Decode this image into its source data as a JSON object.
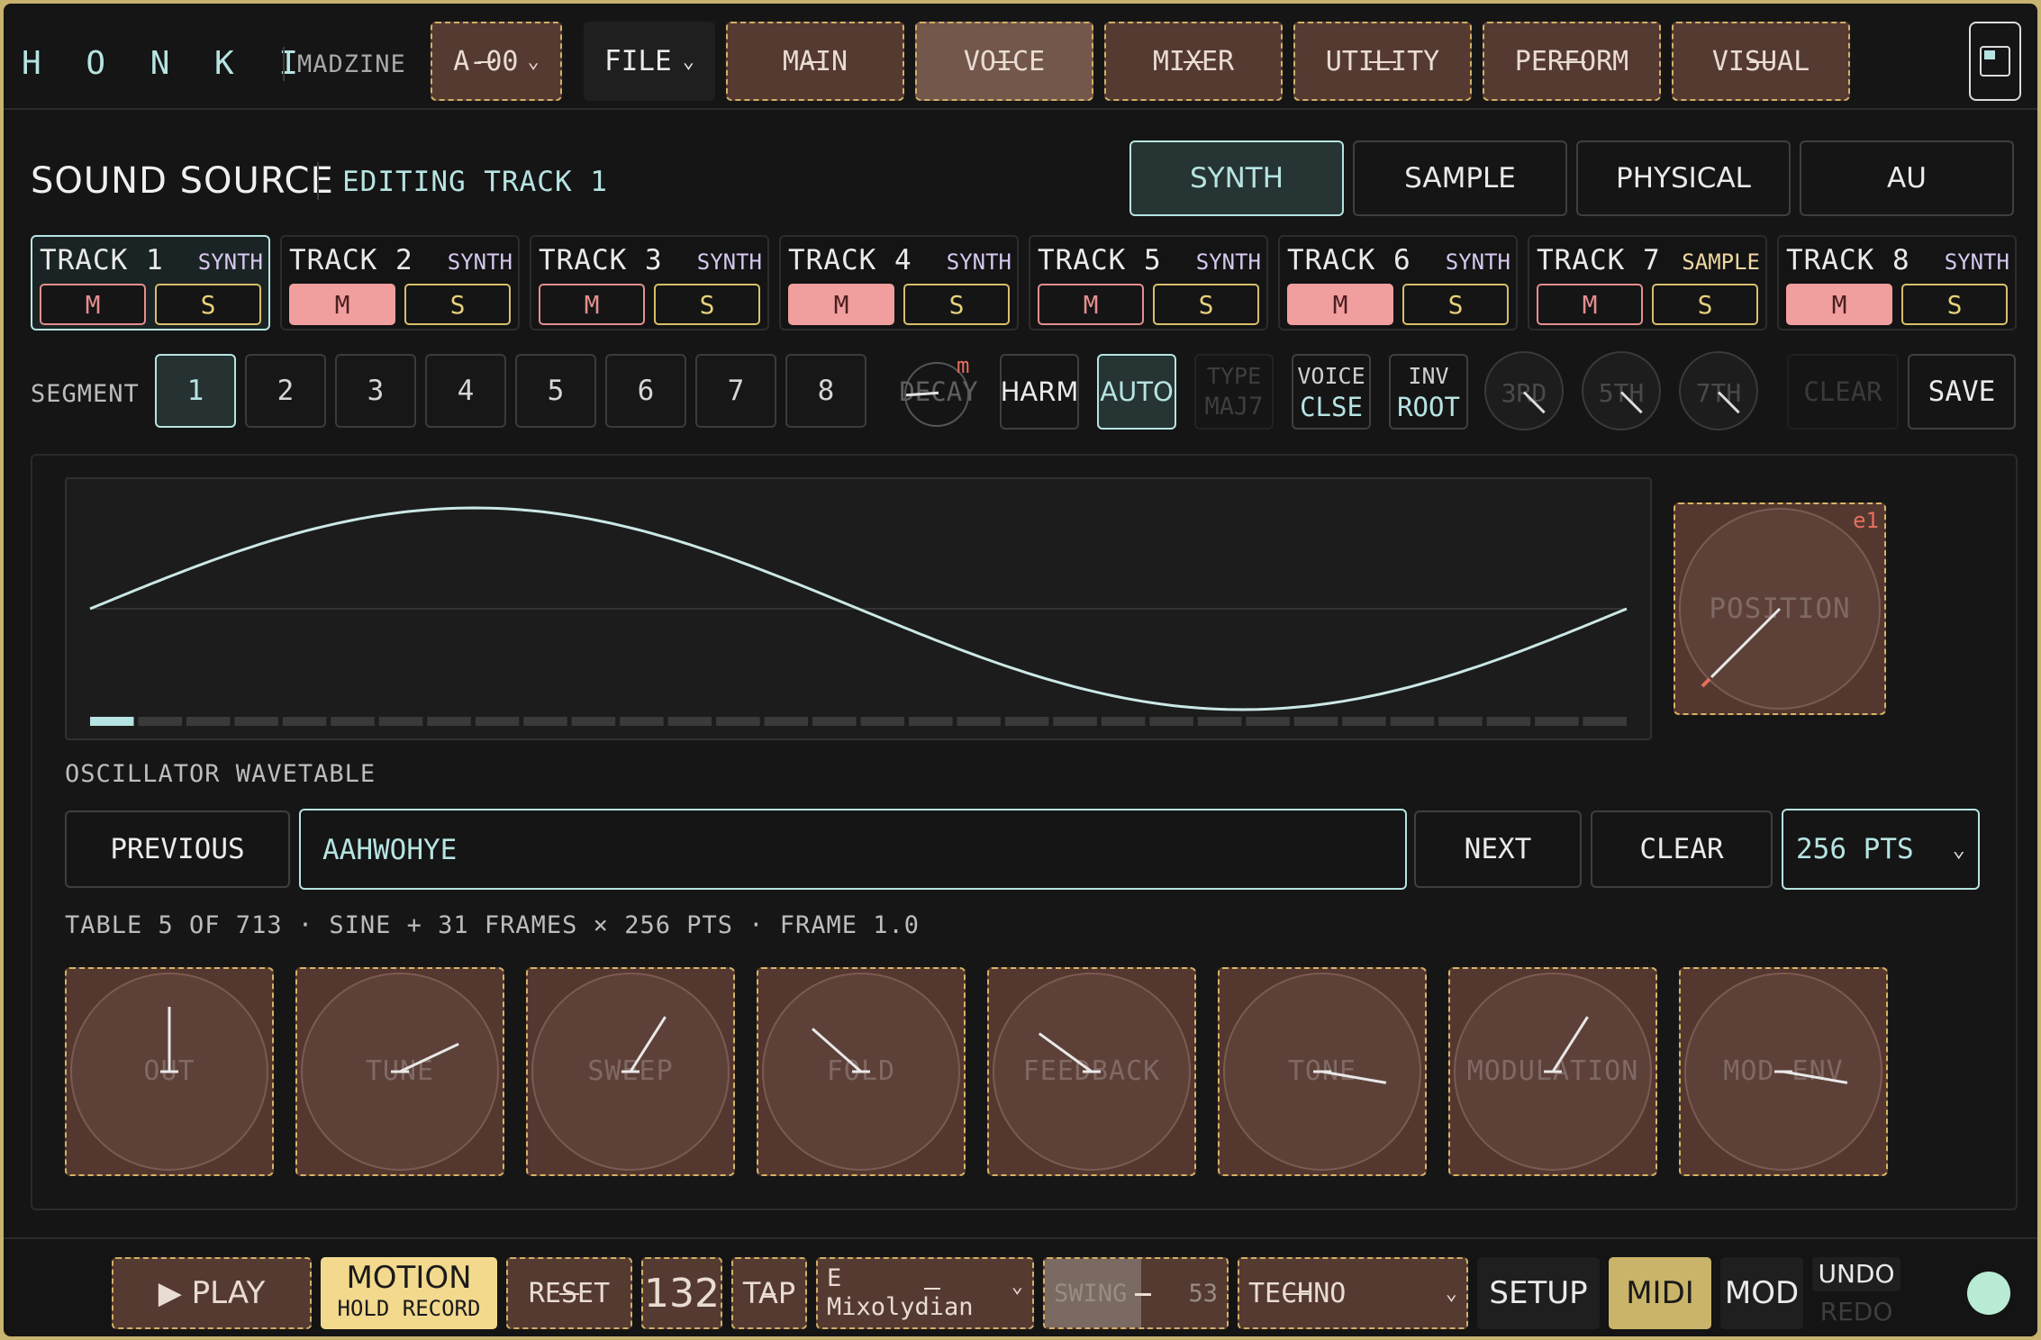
{
  "header": {
    "logo": "H O N K I",
    "madzine_label": "MADZINE",
    "preset": "A-00",
    "file_label": "FILE",
    "tabs": [
      {
        "label": "MAIN",
        "active": false
      },
      {
        "label": "VOICE",
        "active": true
      },
      {
        "label": "MIXER",
        "active": false
      },
      {
        "label": "UTILITY",
        "active": false
      },
      {
        "label": "PERFORM",
        "active": false
      },
      {
        "label": "VISUAL",
        "active": false
      }
    ]
  },
  "section": {
    "title": "SOUND SOURCE",
    "subtitle": "EDITING TRACK 1",
    "source_tabs": [
      {
        "label": "SYNTH",
        "active": true
      },
      {
        "label": "SAMPLE",
        "active": false
      },
      {
        "label": "PHYSICAL",
        "active": false
      },
      {
        "label": "AU",
        "active": false
      }
    ]
  },
  "tracks": [
    {
      "name": "TRACK 1",
      "type": "SYNTH",
      "mute": false,
      "active": true
    },
    {
      "name": "TRACK 2",
      "type": "SYNTH",
      "mute": true,
      "active": false
    },
    {
      "name": "TRACK 3",
      "type": "SYNTH",
      "mute": false,
      "active": false
    },
    {
      "name": "TRACK 4",
      "type": "SYNTH",
      "mute": true,
      "active": false
    },
    {
      "name": "TRACK 5",
      "type": "SYNTH",
      "mute": false,
      "active": false
    },
    {
      "name": "TRACK 6",
      "type": "SYNTH",
      "mute": true,
      "active": false
    },
    {
      "name": "TRACK 7",
      "type": "SAMPLE",
      "mute": false,
      "active": false
    },
    {
      "name": "TRACK 8",
      "type": "SYNTH",
      "mute": true,
      "active": false
    }
  ],
  "track_buttons": {
    "mute": "M",
    "solo": "S"
  },
  "segment": {
    "label": "SEGMENT",
    "items": [
      "1",
      "2",
      "3",
      "4",
      "5",
      "6",
      "7",
      "8"
    ],
    "selected": "1",
    "decay_label": "DECAY",
    "decay_marker": "m",
    "harm_label": "HARM",
    "auto_label": "AUTO",
    "type_label": "TYPE",
    "type_value": "MAJ7",
    "voice_label": "VOICE",
    "voice_value": "CLSE",
    "inv_label": "INV",
    "inv_value": "ROOT",
    "intervals": [
      "3RD",
      "5TH",
      "7TH"
    ],
    "clear_label": "CLEAR",
    "save_label": "SAVE"
  },
  "wavetable": {
    "position_label": "POSITION",
    "position_tag": "e1",
    "frame_count": 32,
    "current_frame": 1,
    "section_label": "OSCILLATOR WAVETABLE",
    "previous_label": "PREVIOUS",
    "name": "AAHWOHYE",
    "next_label": "NEXT",
    "clear_label": "CLEAR",
    "points": "256 PTS",
    "info": "TABLE 5 OF 713 · SINE + 31 FRAMES × 256 PTS · FRAME 1.0"
  },
  "knobs": [
    {
      "label": "OUT",
      "value": 0.5
    },
    {
      "label": "TUNE",
      "value": 0.74
    },
    {
      "label": "SWEEP",
      "value": 0.62
    },
    {
      "label": "FOLD",
      "value": 0.32
    },
    {
      "label": "FEEDBACK",
      "value": 0.3
    },
    {
      "label": "TONE",
      "value": 0.87
    },
    {
      "label": "MODULATION",
      "value": 0.62
    },
    {
      "label": "MOD-ENV",
      "value": 0.87
    }
  ],
  "transport": {
    "play_label": "▶ PLAY",
    "motion_label": "MOTION",
    "motion_sub": "HOLD RECORD",
    "reset_label": "RESET",
    "tempo": "132",
    "tap_label": "TAP",
    "scale_key": "E",
    "scale_mode": "Mixolydian",
    "swing_label": "SWING",
    "swing_value": "53",
    "swing_fraction": 0.53,
    "genre": "TECHNO",
    "setup_label": "SETUP",
    "midi_label": "MIDI",
    "mod_label": "MOD",
    "undo_label": "UNDO",
    "redo_label": "REDO"
  },
  "colors": {
    "accent_cyan": "#b6e4e2",
    "mute_pink": "#f19e9e",
    "solo_yellow": "#d8c06a",
    "brown_bg": "#553a32",
    "motion_yellow": "#f3d98d",
    "midi_gold": "#c9b46a",
    "frame_gold": "#c8b36f"
  }
}
